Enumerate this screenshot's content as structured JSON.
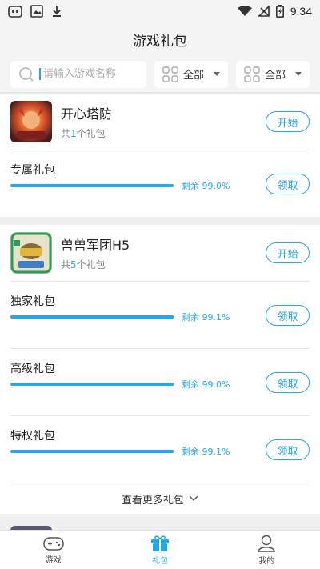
{
  "status_bar": {
    "time": "9:34"
  },
  "header": {
    "title": "游戏礼包"
  },
  "filter": {
    "search_placeholder": "请输入游戏名称",
    "dropdown_1": "全部",
    "dropdown_2": "全部"
  },
  "games": [
    {
      "name": "开心塔防",
      "count_prefix": "共",
      "count": "1",
      "count_suffix": "个礼包",
      "action": "开始",
      "gifts": [
        {
          "name": "专属礼包",
          "remain_label": "剩余 99.0%",
          "remain_pct": 99.0,
          "action": "领取"
        }
      ]
    },
    {
      "name": "兽兽军团H5",
      "count_prefix": "共",
      "count": "5",
      "count_suffix": "个礼包",
      "action": "开始",
      "gifts": [
        {
          "name": "独家礼包",
          "remain_label": "剩余 99.1%",
          "remain_pct": 99.1,
          "action": "领取"
        },
        {
          "name": "高级礼包",
          "remain_label": "剩余 99.0%",
          "remain_pct": 99.0,
          "action": "领取"
        },
        {
          "name": "特权礼包",
          "remain_label": "剩余 99.1%",
          "remain_pct": 99.1,
          "action": "领取"
        }
      ],
      "more_label": "查看更多礼包"
    }
  ],
  "tabs": [
    {
      "label": "游戏",
      "icon": "gamepad-icon"
    },
    {
      "label": "礼包",
      "icon": "gift-icon",
      "active": true
    },
    {
      "label": "我的",
      "icon": "user-icon"
    }
  ],
  "colors": {
    "accent": "#26a8e6",
    "background": "#efefef"
  }
}
